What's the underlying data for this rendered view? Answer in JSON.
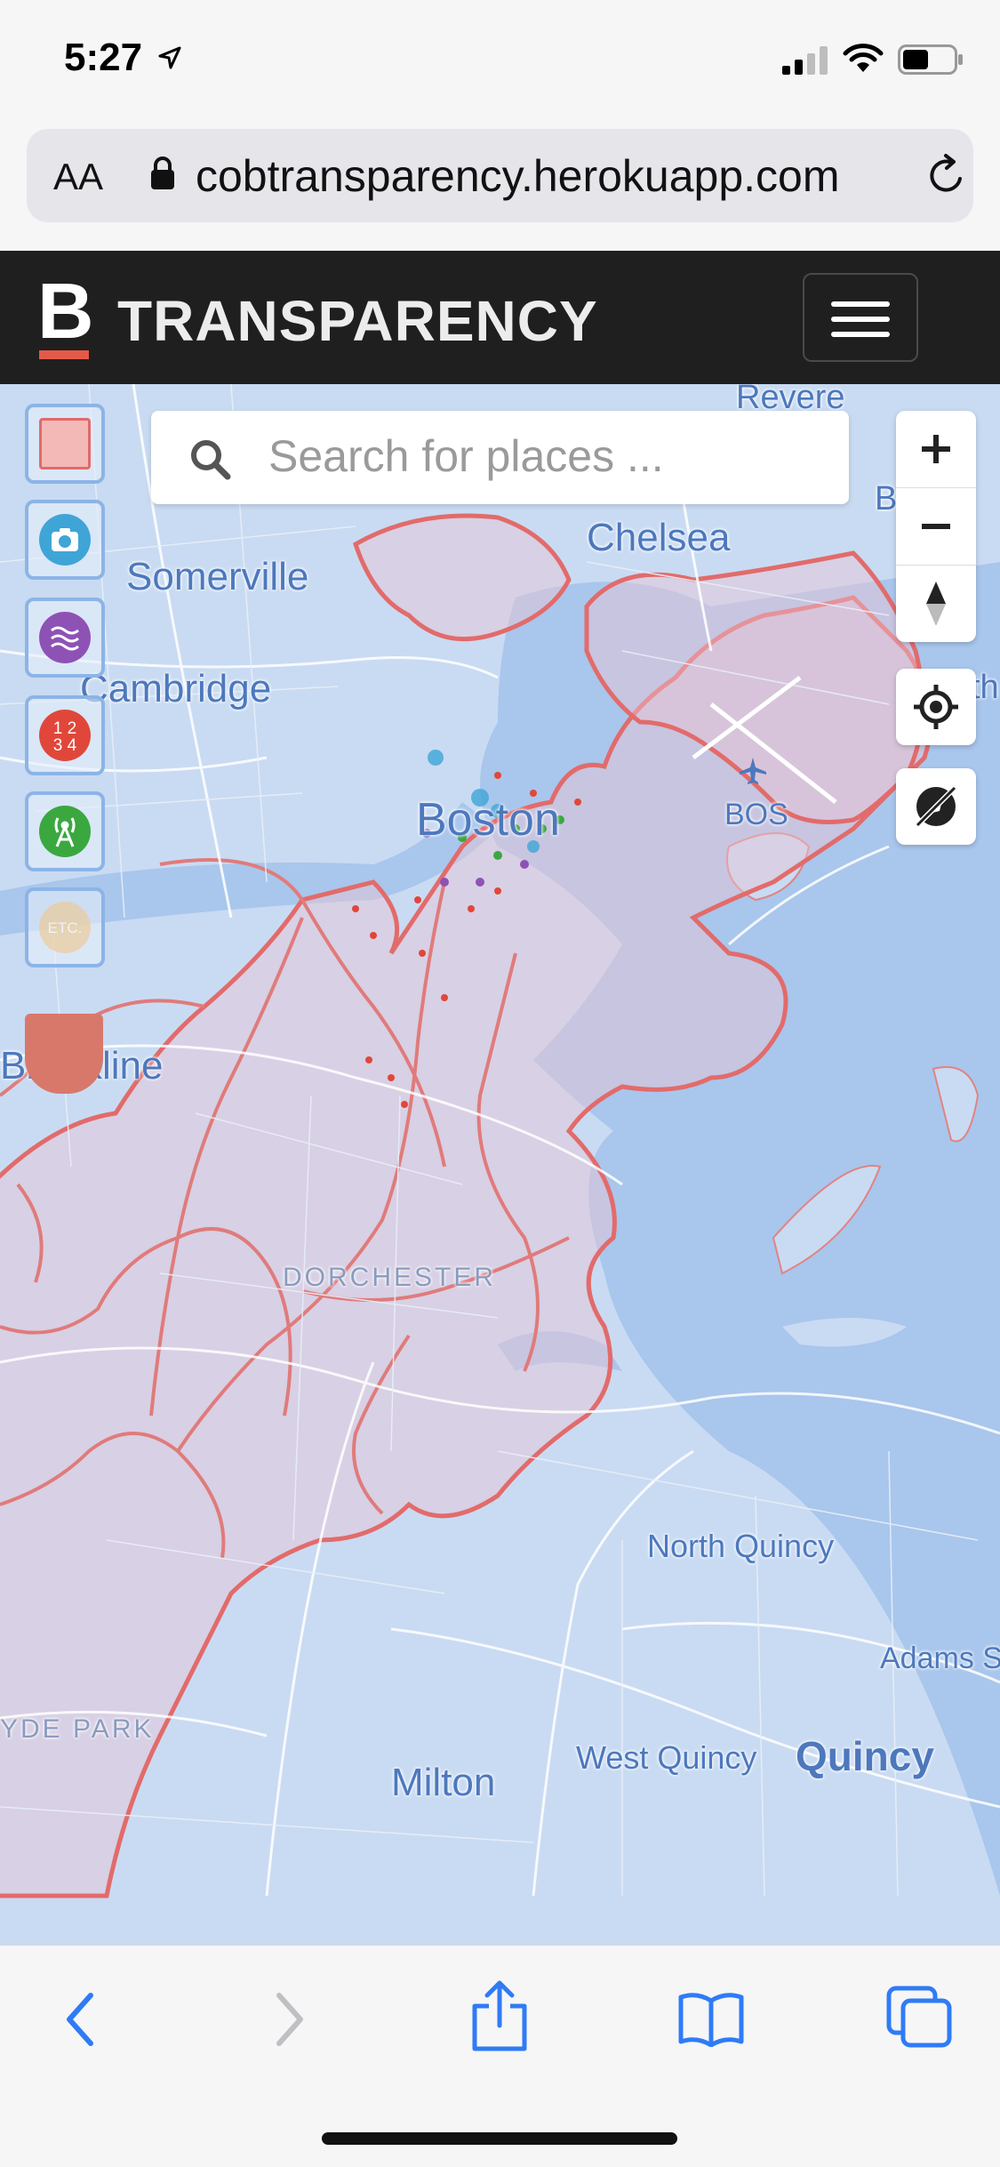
{
  "status_bar": {
    "time": "5:27",
    "icons": [
      "location-arrow-icon",
      "signal-icon",
      "wifi-icon",
      "battery-icon"
    ]
  },
  "browser": {
    "text_size_label": "AA",
    "url": "cobtransparency.herokuapp.com",
    "icons": [
      "lock-icon",
      "reload-icon"
    ]
  },
  "app_header": {
    "logo_letter": "B",
    "title": "TRANSPARENCY",
    "menu_icon": "hamburger-icon"
  },
  "search": {
    "placeholder": "Search for places ..."
  },
  "layer_buttons": [
    {
      "name": "boundaries",
      "color": "#f2b9b6"
    },
    {
      "name": "camera",
      "color": "#3fa5d6"
    },
    {
      "name": "waves",
      "color": "#8e52b5"
    },
    {
      "name": "numbers",
      "label": "12\n34",
      "color": "#e0473a"
    },
    {
      "name": "antenna",
      "color": "#3aa83f"
    },
    {
      "name": "etc",
      "label": "ETC.",
      "color": "#f0c78a"
    }
  ],
  "map_controls": [
    "zoom-in-icon",
    "zoom-out-icon",
    "compass-icon",
    "locate-icon",
    "gps-off-icon"
  ],
  "map_labels": {
    "revere": "Revere",
    "chelsea": "Chelsea",
    "somerville": "Somerville",
    "cambridge": "Cambridge",
    "boston": "Boston",
    "bos": "BOS",
    "brookline": "Brookline",
    "dorchester": "DORCHESTER",
    "north_quincy": "North Quincy",
    "adams": "Adams S",
    "hyde_park": "YDE PARK",
    "west_quincy": "West Quincy",
    "quincy": "Quincy",
    "milton": "Milton",
    "b_edge": "B",
    "th_edge": "th"
  },
  "toolbar": [
    "back-icon",
    "forward-icon",
    "share-icon",
    "bookmarks-icon",
    "tabs-icon"
  ],
  "colors": {
    "header_bg": "#1f1f1f",
    "accent": "#e35a4a",
    "map_water": "#a9c6ec",
    "map_land": "#c9dbf2",
    "boundary": "#e26b6b"
  }
}
